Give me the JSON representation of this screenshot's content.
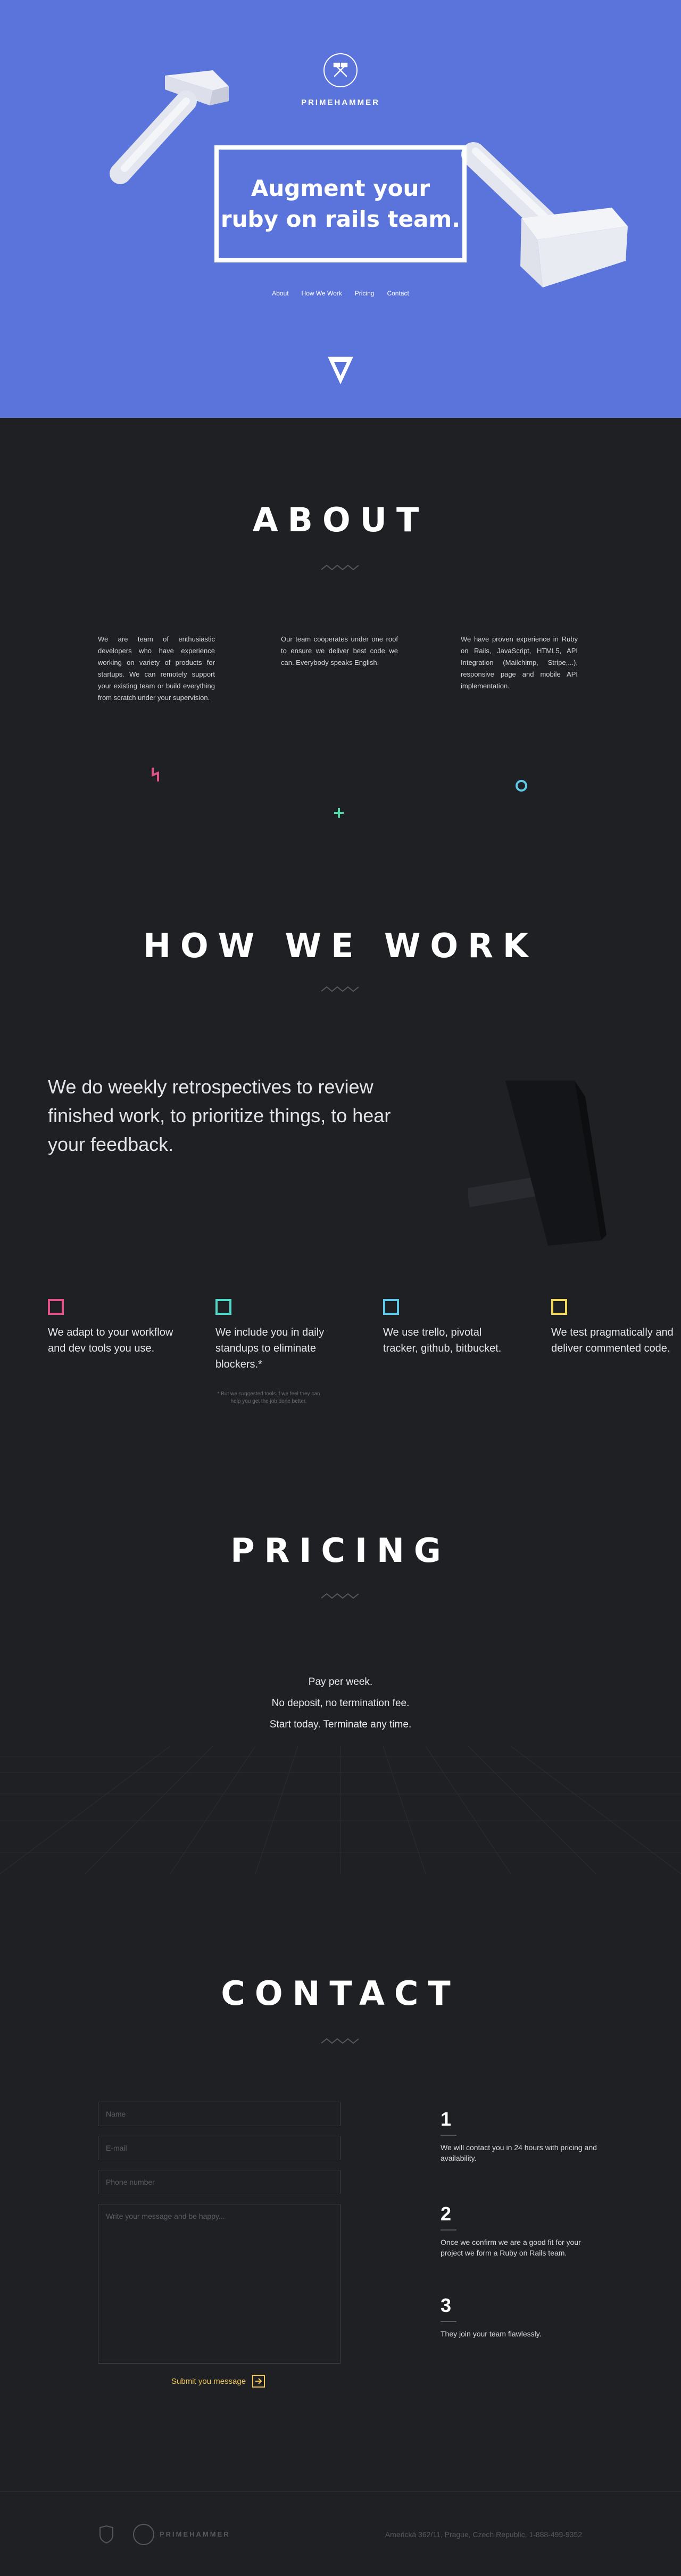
{
  "brand": {
    "name": "PRIMEHAMMER",
    "accent": "#5a74dc",
    "bg": "#1f2024"
  },
  "hero": {
    "title": "Augment your ruby on rails team.",
    "nav": [
      "About",
      "How We Work",
      "Pricing",
      "Contact"
    ]
  },
  "about": {
    "title": "ABOUT",
    "columns": [
      "We are team of enthusiastic developers who have experience working on variety of products for startups. We can remotely support your existing team or build everything from scratch under your supervision.",
      "Our team cooperates under one roof to ensure we deliver best code we can. Everybody speaks English.",
      "We have proven experience in Ruby on Rails, JavaScript, HTML5, API Integration (Mailchimp, Stripe,...), responsive page and mobile API implementation."
    ]
  },
  "how_we_work": {
    "title": "HOW WE WORK",
    "lead": "We do weekly retrospectives to review finished work, to prioritize things, to hear your feedback.",
    "items": [
      {
        "text": "We adapt to your workflow and dev tools you use.",
        "color": "#e0528a"
      },
      {
        "text": "We include you in daily standups to eliminate blockers.*",
        "color": "#4fd8c8"
      },
      {
        "text": "We use trello, pivotal tracker, github, bitbucket.",
        "color": "#5fc8e6"
      },
      {
        "text": "We test pragmatically and deliver commented code.",
        "color": "#f0d860"
      }
    ],
    "footnote": "* But we suggested tools if we feel they can help you get the job done better."
  },
  "pricing": {
    "title": "PRICING",
    "lines": [
      "Pay per week.",
      "No deposit, no termination fee.",
      "Start today. Terminate any time."
    ]
  },
  "contact": {
    "title": "CONTACT",
    "name_placeholder": "Name",
    "email_placeholder": "E-mail",
    "phone_placeholder": "Phone number",
    "message_placeholder": "Write your message and be happy...",
    "submit_label": "Submit you message",
    "steps": [
      {
        "num": "1",
        "text": "We will contact you in 24 hours with pricing and availability."
      },
      {
        "num": "2",
        "text": "Once we confirm we are a good fit for your project we form a Ruby on Rails team."
      },
      {
        "num": "3",
        "text": "They join your team flawlessly."
      }
    ]
  },
  "footer": {
    "name": "PRIMEHAMMER",
    "address": "Americká 362/11, Prague, Czech Republic, 1-888-499-9352"
  }
}
